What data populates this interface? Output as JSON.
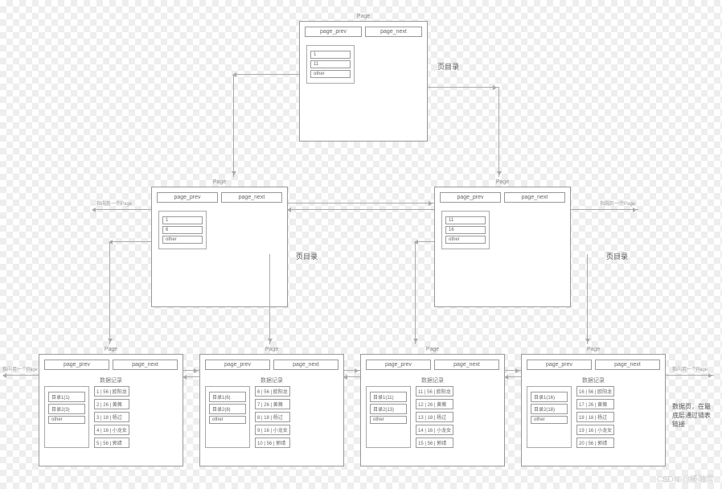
{
  "labels": {
    "page": "Page",
    "page_prev": "page_prev",
    "page_next": "page_next",
    "dir": "页目录",
    "records": "数据记录",
    "edge": "指向另一个Page",
    "side_note": "数据页，在最底层通过链表链接",
    "watermark": "CSDN @椿融雪"
  },
  "root": {
    "items": [
      "1",
      "11",
      "other"
    ]
  },
  "mid": [
    {
      "items": [
        "1",
        "6",
        "other"
      ]
    },
    {
      "items": [
        "11",
        "16",
        "other"
      ]
    }
  ],
  "leaves": [
    {
      "dir": [
        "目录1(1)",
        "目录2(3)",
        "other"
      ],
      "rec": [
        "1 | 56 | 欧阳龙",
        "2 | 26 | 黄薇",
        "3 | 18 | 杨过",
        "4 | 16 | 小龙女",
        "5 | 56 | 郭靖"
      ]
    },
    {
      "dir": [
        "目录1(6)",
        "目录2(8)",
        "other"
      ],
      "rec": [
        "6 | 56 | 欧阳龙",
        "7 | 26 | 黄薇",
        "8 | 18 | 杨过",
        "9 | 16 | 小龙女",
        "10 | 56 | 郭靖"
      ]
    },
    {
      "dir": [
        "目录1(11)",
        "目录2(13)",
        "other"
      ],
      "rec": [
        "11 | 56 | 欧阳龙",
        "12 | 26 | 黄薇",
        "13 | 18 | 杨过",
        "14 | 16 | 小龙女",
        "15 | 56 | 郭靖"
      ]
    },
    {
      "dir": [
        "目录1(16)",
        "目录2(18)",
        "other"
      ],
      "rec": [
        "16 | 56 | 欧阳龙",
        "17 | 26 | 黄薇",
        "18 | 18 | 杨过",
        "19 | 16 | 小龙女",
        "20 | 56 | 郭靖"
      ]
    }
  ]
}
